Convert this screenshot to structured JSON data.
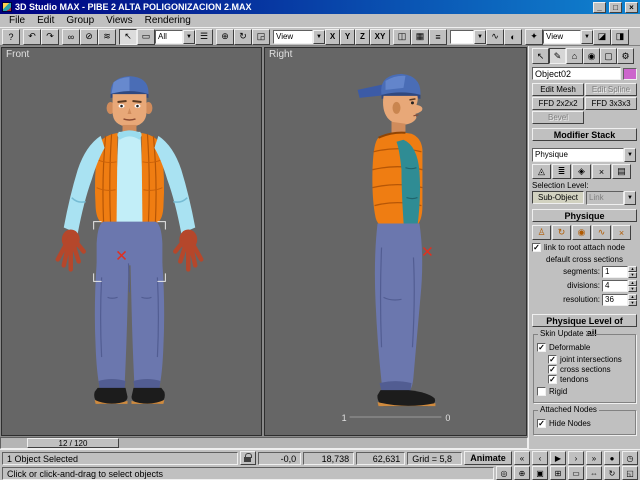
{
  "window": {
    "title": "3D Studio MAX - PIBE 2 ALTA POLIGONIZACION 2.MAX",
    "minimize": "_",
    "maximize": "□",
    "close": "×"
  },
  "menu": {
    "items": [
      "File",
      "Edit",
      "Group",
      "Views",
      "Rendering"
    ]
  },
  "icons": {
    "dd_arrow": "▼",
    "spin_up": "▲",
    "spin_down": "▼"
  },
  "toolbar": {
    "help": "?",
    "undo": "↶",
    "redo": "↷",
    "select_link": "∞",
    "unlink": "⊘",
    "bind_spacewarp": "≋",
    "select_object": "↖",
    "region": "▭",
    "filter": "All",
    "select_by_name": "☰",
    "move": "⊕",
    "rotate": "↻",
    "scale": "◲",
    "coord_system": "View",
    "ax_x": "X",
    "ax_y": "Y",
    "ax_z": "Z",
    "ax_xy": "XY",
    "mirror": "◫",
    "array": "▦",
    "align": "≡",
    "named_sets": "",
    "track_view": "∿",
    "material_editor": "◐",
    "render_scene": "✦",
    "render_type": "View",
    "quick_render": "◪",
    "render_last": "◨"
  },
  "viewports": {
    "front": "Front",
    "right": "Right",
    "marker_1": "1",
    "marker_0": "0"
  },
  "timeline": {
    "handle": "12 / 120"
  },
  "status": {
    "selected": "1 Object Selected",
    "prompt": "Click or click-and-drag to select objects",
    "x": "-0,0",
    "y": "18,738",
    "z": "62,631",
    "grid": "Grid = 5,8",
    "animate": "Animate"
  },
  "time_controls": {
    "go_start": "«",
    "prev": "‹",
    "play": "▶",
    "next": "›",
    "go_end": "»",
    "key_mode": "●",
    "time_config": "◷"
  },
  "nav": {
    "zoom": "◎",
    "zoom_all": "⊕",
    "zoom_extents": "▣",
    "zoom_extents_all": "⊞",
    "region_zoom": "▭",
    "pan": "⇔",
    "arc_rotate": "↻",
    "min_max": "◱"
  },
  "panel": {
    "tabs": {
      "create": "↖",
      "modify": "✎",
      "hierarchy": "⌂",
      "motion": "◉",
      "display": "▢",
      "utilities": "⚙"
    },
    "object_name": "Object02",
    "object_color": "#cc66cc",
    "swatch_style": "background:#cc66cc",
    "buttons": {
      "edit_mesh": "Edit Mesh",
      "edit_spline": "Edit Spline",
      "ffd22": "FFD 2x2x2",
      "ffd33": "FFD 3x3x3",
      "bevel": "Bevel"
    },
    "stack": {
      "header": "Modifier Stack",
      "modifier": "Physique",
      "selection_level_label": "Selection Level:",
      "sub_object": "Sub-Object",
      "sub_object_level": "Link"
    },
    "stack_tools": {
      "pin": "◬",
      "show_end": "≣",
      "unique": "◈",
      "remove": "×",
      "edit": "▤"
    },
    "phys_tools": {
      "attach": "♙",
      "reinit": "↻",
      "bulge": "◉",
      "tendon": "∿",
      "delete": "×"
    },
    "physique": {
      "header": "Physique",
      "link_root_label": "link to root attach node",
      "cross_label": "default cross sections",
      "segments_label": "segments:",
      "segments_value": "1",
      "divisions_label": "divisions:",
      "divisions_value": "4",
      "resolution_label": "resolution:",
      "resolution_value": "36"
    },
    "lod": {
      "header": "Physique Level of Detail",
      "skin_update_label": "Skin Update",
      "deformable_label": "Deformable",
      "joint_label": "joint intersections",
      "cross_label": "cross sections",
      "tendons_label": "tendons",
      "rigid_label": "Rigid",
      "attached_label": "Attached Nodes",
      "hide_label": "Hide Nodes"
    },
    "checks": {
      "link_root": "✓",
      "deformable": "✓",
      "joint": "✓",
      "cross": "✓",
      "tendons": "✓",
      "rigid": "",
      "hide_nodes": "✓"
    }
  }
}
